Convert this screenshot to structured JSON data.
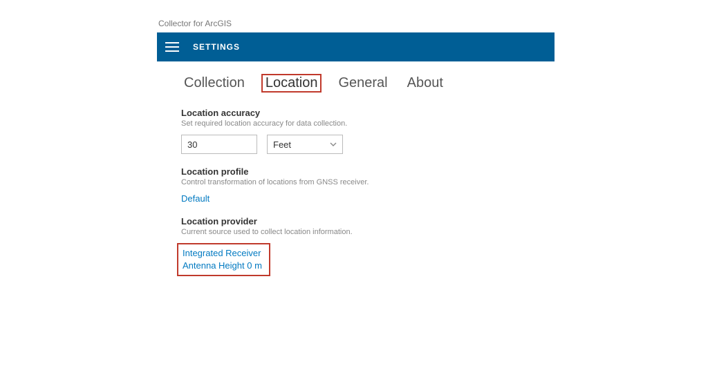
{
  "window": {
    "title": "Collector for ArcGIS"
  },
  "appbar": {
    "title": "SETTINGS"
  },
  "tabs": {
    "collection": "Collection",
    "location": "Location",
    "general": "General",
    "about": "About"
  },
  "accuracy": {
    "title": "Location accuracy",
    "desc": "Set required location accuracy for data collection.",
    "value": "30",
    "unit": "Feet"
  },
  "profile": {
    "title": "Location profile",
    "desc": "Control transformation of locations from GNSS receiver.",
    "link": "Default"
  },
  "provider": {
    "title": "Location provider",
    "desc": "Current source used to collect location information.",
    "line1": "Integrated Receiver",
    "line2": "Antenna Height 0 m"
  }
}
